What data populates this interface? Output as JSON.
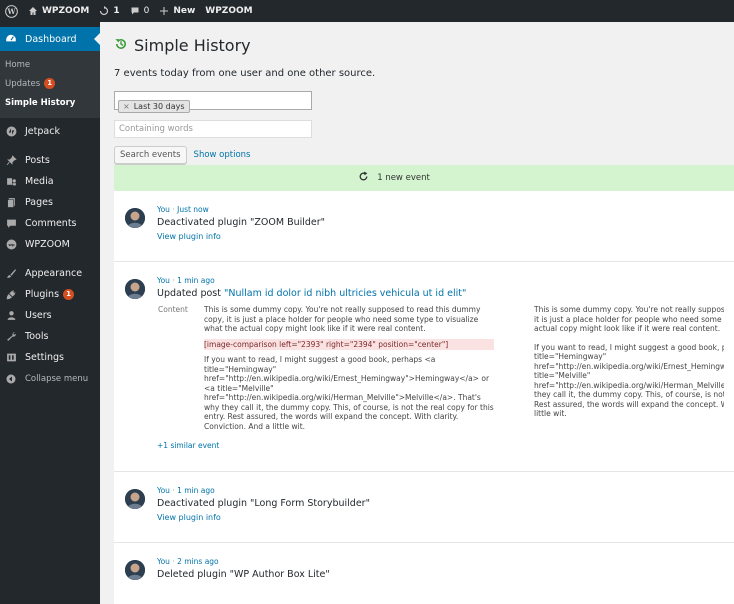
{
  "admin_bar": {
    "site_name": "WPZOOM",
    "updates_count": "1",
    "comments_count": "0",
    "new_label": "New",
    "zoom_label": "WPZOOM"
  },
  "sidebar": {
    "dashboard": "Dashboard",
    "sub_home": "Home",
    "sub_updates": "Updates",
    "sub_updates_badge": "1",
    "sub_simple_history": "Simple History",
    "jetpack": "Jetpack",
    "posts": "Posts",
    "media": "Media",
    "pages": "Pages",
    "comments": "Comments",
    "wpzoom": "WPZOOM",
    "appearance": "Appearance",
    "plugins": "Plugins",
    "plugins_badge": "1",
    "users": "Users",
    "tools": "Tools",
    "settings": "Settings",
    "collapse": "Collapse menu"
  },
  "page": {
    "title": "Simple History",
    "intro": "7 events today from one user and one other source.",
    "date_chip": "Last 30 days",
    "words_placeholder": "Containing words",
    "search_button": "Search events",
    "show_options": "Show options",
    "new_event": "1 new event"
  },
  "events": [
    {
      "who": "You",
      "when": "Just now",
      "text": "Deactivated plugin \"ZOOM Builder\"",
      "link": "View plugin info"
    },
    {
      "who": "You",
      "when": "1 min ago",
      "text_prefix": "Updated post ",
      "text_quoted": "\"Nullam id dolor id nibh ultricies vehicula ut id elit\"",
      "diff_label": "Content",
      "left_p1": "This is some dummy copy. You're not really supposed to read this dummy copy, it is just a place holder for people who need some type to visualize what the actual copy might look like if it were real content.",
      "left_removed": "[image-comparison left=\"2393\" right=\"2394\" position=\"center\"]",
      "left_p2": "If you want to read, I might suggest a good book, perhaps <a title=\"Hemingway\" href=\"http://en.wikipedia.org/wiki/Ernest_Hemingway\">Hemingway</a> or <a title=\"Melville\" href=\"http://en.wikipedia.org/wiki/Herman_Melville\">Melville</a>. That's why they call it, the dummy copy. This, of course, is not the real copy for this entry. Rest assured, the words will expand the concept. With clarity. Conviction. And a little wit.",
      "right_p1": "This is some dummy copy. You're not really supposed to read this dummy copy, it is just a place holder for people who need some type to visualize what the actual copy might look like if it were real content.",
      "right_p2": "If you want to read, I might suggest a good book, perhaps <a title=\"Hemingway\" href=\"http://en.wikipedia.org/wiki/Ernest_Hemingway\">Hemingway</a> or <a title=\"Melville\" href=\"http://en.wikipedia.org/wiki/Herman_Melville\">Melville</a>. That's why they call it, the dummy copy. This, of course, is not the real copy for this entry. Rest assured, the words will expand the concept. With clarity. Conviction. And a little wit.",
      "similar": "+1 similar event"
    },
    {
      "who": "You",
      "when": "1 min ago",
      "text": "Deactivated plugin \"Long Form Storybuilder\"",
      "link": "View plugin info"
    },
    {
      "who": "You",
      "when": "2 mins ago",
      "text": "Deleted plugin \"WP Author Box Lite\""
    }
  ],
  "colors": {
    "admin_dark": "#23282d",
    "accent_blue": "#0073aa",
    "badge_orange": "#d54e21",
    "new_event_green": "#d4f4d0",
    "removed_red": "#fbe2e2"
  }
}
